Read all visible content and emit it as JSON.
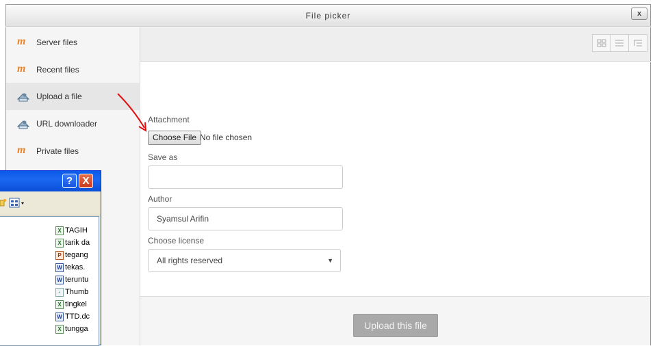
{
  "dialog": {
    "title": "File picker",
    "close_label": "x"
  },
  "sidebar": {
    "items": [
      {
        "label": "Server files",
        "icon": "moodle-icon"
      },
      {
        "label": "Recent files",
        "icon": "moodle-icon"
      },
      {
        "label": "Upload a file",
        "icon": "upload-icon",
        "active": true
      },
      {
        "label": "URL downloader",
        "icon": "upload-icon"
      },
      {
        "label": "Private files",
        "icon": "moodle-icon"
      }
    ]
  },
  "toolbar": {
    "view_buttons": [
      "icons-view-icon",
      "list-view-icon",
      "tree-view-icon"
    ]
  },
  "form": {
    "attachment_label": "Attachment",
    "choose_file_label": "Choose File",
    "no_file_text": "No file chosen",
    "save_as_label": "Save as",
    "save_as_value": "",
    "author_label": "Author",
    "author_value": "Syamsul Arifin",
    "license_label": "Choose license",
    "license_value": "All rights reserved",
    "upload_button": "Upload this file"
  },
  "overlay_dialog": {
    "help_label": "?",
    "close_label": "X",
    "files": [
      {
        "name": "TAGIH",
        "type": "excel"
      },
      {
        "name": "tarik da",
        "type": "excel"
      },
      {
        "name": "tegang",
        "type": "powerpoint"
      },
      {
        "name": "tekas.",
        "type": "word"
      },
      {
        "name": "teruntu",
        "type": "word"
      },
      {
        "name": "Thumb",
        "type": "image"
      },
      {
        "name": "tingkel",
        "type": "excel"
      },
      {
        "name": "TTD.dc",
        "type": "word"
      },
      {
        "name": "tungga",
        "type": "excel"
      }
    ]
  },
  "colors": {
    "annotation_arrow": "#e01010",
    "moodle_orange": "#e8852a",
    "xp_title_blue": "#0a58e8"
  }
}
